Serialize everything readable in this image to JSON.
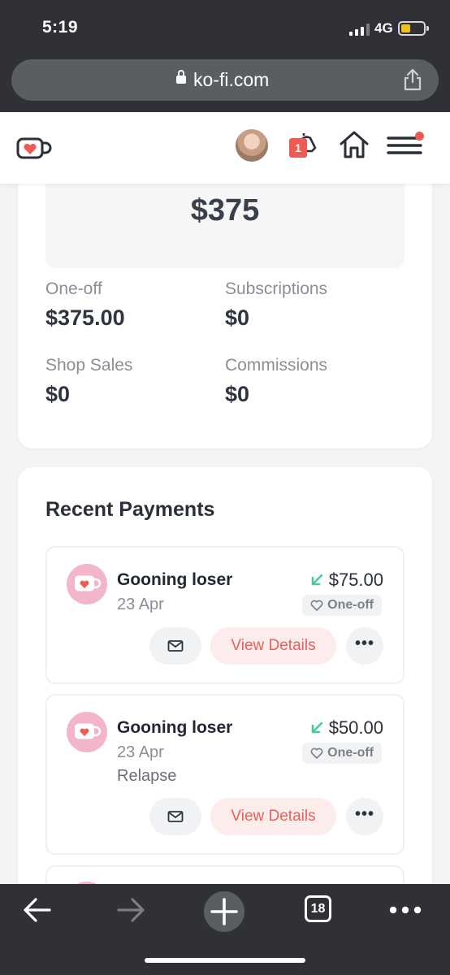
{
  "status": {
    "time": "5:19",
    "network": "4G"
  },
  "browser": {
    "url": "ko-fi.com",
    "tab_count": "18"
  },
  "header": {
    "notification_count": "1"
  },
  "summary": {
    "total": "$375",
    "stats": [
      {
        "label": "One-off",
        "value": "$375.00"
      },
      {
        "label": "Subscriptions",
        "value": "$0"
      },
      {
        "label": "Shop Sales",
        "value": "$0"
      },
      {
        "label": "Commissions",
        "value": "$0"
      }
    ]
  },
  "recent": {
    "title": "Recent Payments",
    "payments": [
      {
        "name": "Gooning loser",
        "date": "23 Apr",
        "amount": "$75.00",
        "type": "One-off",
        "note": "",
        "view_label": "View Details",
        "more_label": "•••"
      },
      {
        "name": "Gooning loser",
        "date": "23 Apr",
        "amount": "$50.00",
        "type": "One-off",
        "note": "Relapse",
        "view_label": "View Details",
        "more_label": "•••"
      }
    ]
  },
  "colors": {
    "accent": "#e5615c",
    "badge": "#ef5a55",
    "incoming": "#4cc9a0",
    "chrome": "#2f3136"
  }
}
